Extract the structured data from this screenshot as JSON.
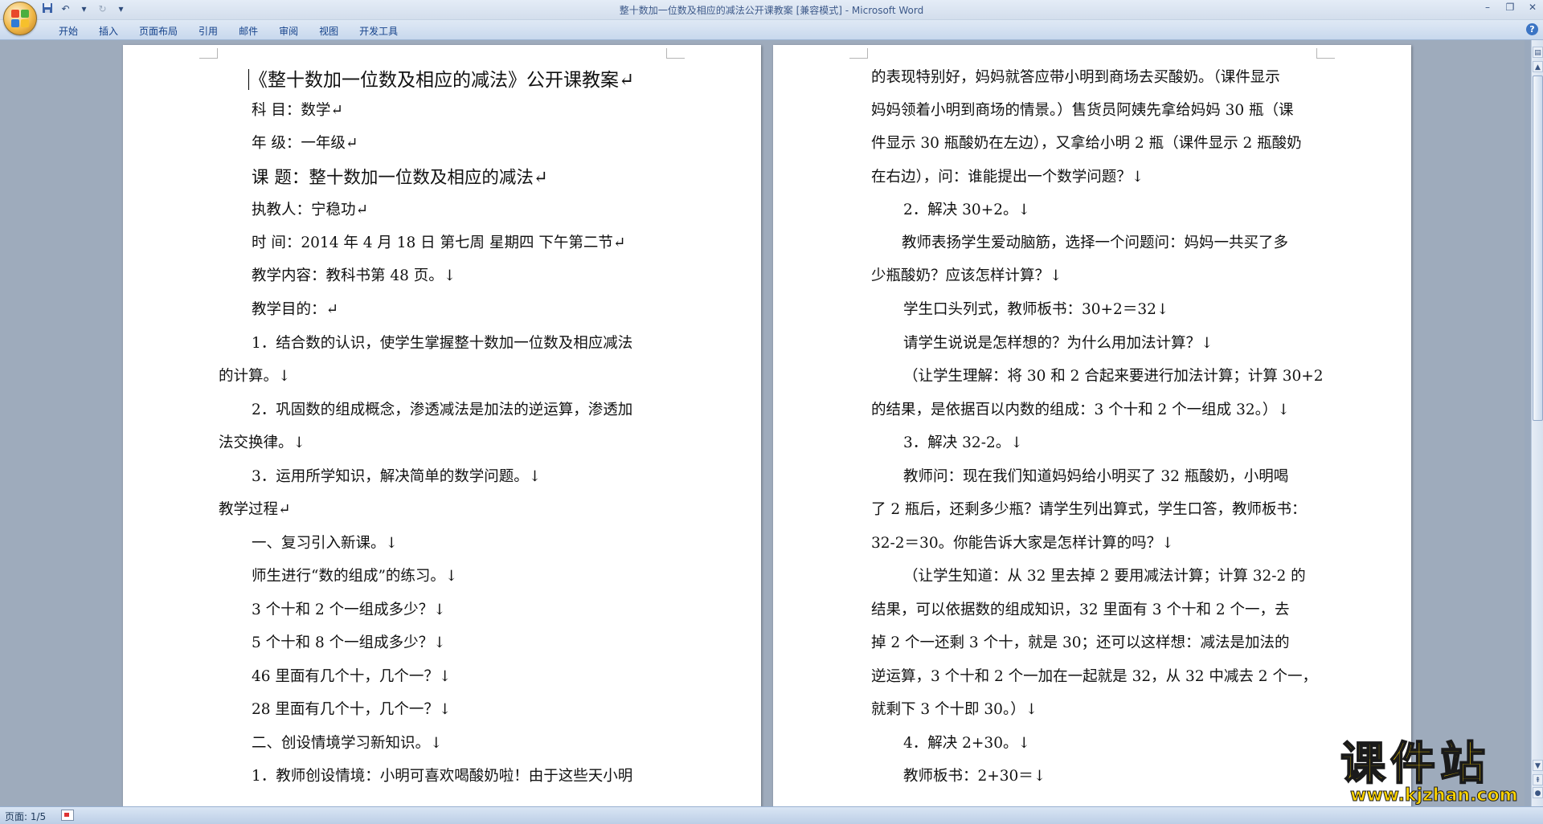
{
  "window": {
    "title": "整十数加一位数及相应的减法公开课教案 [兼容模式] - Microsoft Word"
  },
  "qat": {
    "save": "save-icon",
    "undo": "undo-icon",
    "redo": "redo-icon",
    "customize": "▾"
  },
  "ribbon": {
    "tabs": [
      "开始",
      "插入",
      "页面布局",
      "引用",
      "邮件",
      "审阅",
      "视图",
      "开发工具"
    ]
  },
  "document": {
    "left_page": [
      "《整十数加一位数及相应的减法》公开课教案↵",
      "科    目：数学↵",
      "年    级：一年级↵",
      "课    题：整十数加一位数及相应的减法↵",
      "执教人：宁稳功↵",
      "时    间：2014 年 4 月 18 日    第七周    星期四    下午第二节↵",
      "教学内容：教科书第 48 页。↓",
      "教学目的：↵",
      "1．结合数的认识，使学生掌握整十数加一位数及相应减法",
      "的计算。↓",
      "2．巩固数的组成概念，渗透减法是加法的逆运算，渗透加",
      "法交换律。↓",
      "3．运用所学知识，解决简单的数学问题。↓",
      "教学过程↵",
      "一、复习引入新课。↓",
      "师生进行“数的组成”的练习。↓",
      "3 个十和 2 个一组成多少？↓",
      "5 个十和 8 个一组成多少？↓",
      "46 里面有几个十，几个一？↓",
      "28 里面有几个十，几个一？↓",
      "二、创设情境学习新知识。↓",
      "1．教师创设情境：小明可喜欢喝酸奶啦！由于这些天小明"
    ],
    "right_page": [
      "的表现特别好，妈妈就答应带小明到商场去买酸奶。（课件显示",
      "妈妈领着小明到商场的情景。）售货员阿姨先拿给妈妈 30 瓶（课",
      "件显示 30 瓶酸奶在左边），又拿给小明 2 瓶（课件显示 2 瓶酸奶",
      "在右边），问：谁能提出一个数学问题？↓",
      "2．解决 30+2。↓",
      "教师表扬学生爱动脑筋，选择一个问题问：妈妈一共买了多",
      "少瓶酸奶？应该怎样计算？↓",
      "学生口头列式，教师板书：30+2＝32↓",
      "请学生说说是怎样想的？为什么用加法计算？↓",
      "（让学生理解：将 30 和 2 合起来要进行加法计算；计算 30+2",
      "的结果，是依据百以内数的组成：3 个十和 2 个一组成 32。）↓",
      "3．解决 32-2。↓",
      "教师问：现在我们知道妈妈给小明买了 32 瓶酸奶，小明喝",
      "了 2 瓶后，还剩多少瓶？请学生列出算式，学生口答，教师板书：",
      "32-2＝30。你能告诉大家是怎样计算的吗？↓",
      "（让学生知道：从 32 里去掉 2 要用减法计算；计算 32-2 的",
      "结果，可以依据数的组成知识，32 里面有 3 个十和 2 个一，去",
      "掉 2 个一还剩 3 个十，就是 30；还可以这样想：减法是加法的",
      "逆运算，3 个十和 2 个一加在一起就是 32，从 32 中减去 2 个一，",
      "就剩下 3 个十即 30。）↓",
      "4．解决 2+30。↓",
      "教师板书：2+30＝↓"
    ]
  },
  "statusbar": {
    "page_info": "页面: 1/5"
  },
  "watermark": {
    "name": "课件站",
    "url": "www.kjzhan.com"
  },
  "colors": {
    "accent": "#15428b",
    "watermark": "#ffd500"
  }
}
